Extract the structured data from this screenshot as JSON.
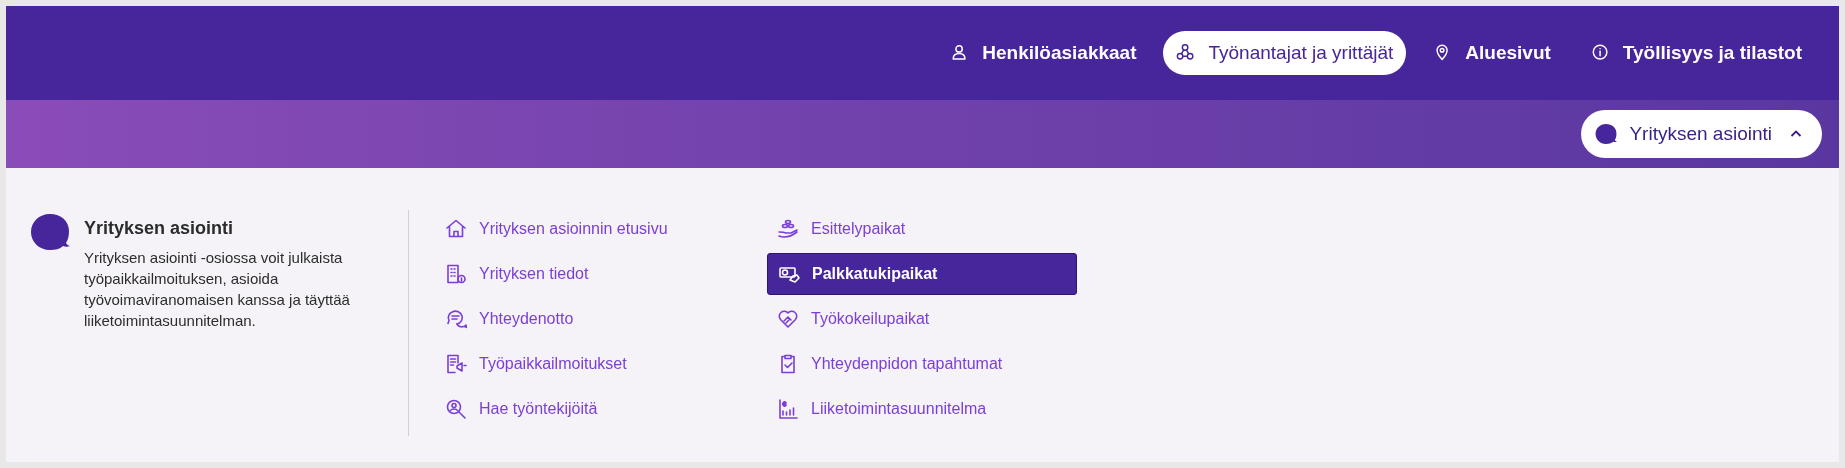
{
  "top_nav": [
    {
      "label": "Henkilöasiakkaat",
      "selected": false
    },
    {
      "label": "Työnantajat ja yrittäjät",
      "selected": true
    },
    {
      "label": "Aluesivut",
      "selected": false
    },
    {
      "label": "Työllisyys ja tilastot",
      "selected": false
    }
  ],
  "section_button": {
    "label": "Yrityksen asiointi",
    "expanded": true
  },
  "intro": {
    "title": "Yrityksen asiointi",
    "text": "Yrityksen asiointi -osiossa voit julkaista työpaikkailmoituksen, asioida työvoimaviranomaisen kanssa ja täyttää liiketoimintasuunnitelman."
  },
  "menu_columns": [
    [
      {
        "label": "Yrityksen asioinnin etusivu",
        "selected": false
      },
      {
        "label": "Yrityksen tiedot",
        "selected": false
      },
      {
        "label": "Yhteydenotto",
        "selected": false
      },
      {
        "label": "Työpaikkailmoitukset",
        "selected": false
      },
      {
        "label": "Hae työntekijöitä",
        "selected": false
      }
    ],
    [
      {
        "label": "Esittelypaikat",
        "selected": false
      },
      {
        "label": "Palkkatukipaikat",
        "selected": true
      },
      {
        "label": "Työkokeilupaikat",
        "selected": false
      },
      {
        "label": "Yhteydenpidon tapahtumat",
        "selected": false
      },
      {
        "label": "Liiketoimintasuunnitelma",
        "selected": false
      }
    ]
  ]
}
